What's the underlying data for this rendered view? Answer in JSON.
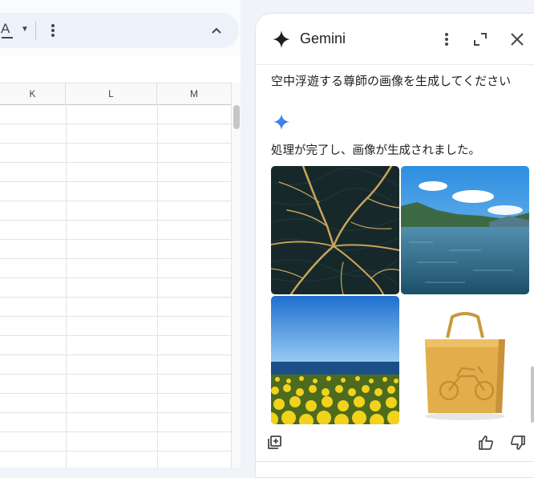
{
  "sheets": {
    "toolbar": {
      "text_color_label": "A",
      "icons": [
        "text-color-icon",
        "caret-down-icon",
        "more-vert-icon",
        "chevron-up-icon"
      ]
    },
    "columns": [
      {
        "label": "K"
      },
      {
        "label": "L"
      },
      {
        "label": "M"
      }
    ]
  },
  "gemini": {
    "title": "Gemini",
    "prompt": "空中浮遊する尊師の画像を生成してください",
    "response": "処理が完了し、画像が生成されました。",
    "images": [
      {
        "name": "generated-image-1",
        "subject": "golden-river-network-aerial"
      },
      {
        "name": "generated-image-2",
        "subject": "lake-with-mountains"
      },
      {
        "name": "generated-image-3",
        "subject": "yellow-flower-field-by-sea"
      },
      {
        "name": "generated-image-4",
        "subject": "mustard-bag-with-motorcycle"
      }
    ],
    "icons": [
      "gemini-spark-icon",
      "more-vert-icon",
      "expand-icon",
      "close-icon",
      "add-to-note-icon",
      "thumbs-up-icon",
      "thumbs-down-icon"
    ],
    "colors": {
      "accent": "#4285f4",
      "text": "#1f1f1f",
      "panel_bg": "#ffffff",
      "app_bg": "#f0f4f9"
    }
  }
}
